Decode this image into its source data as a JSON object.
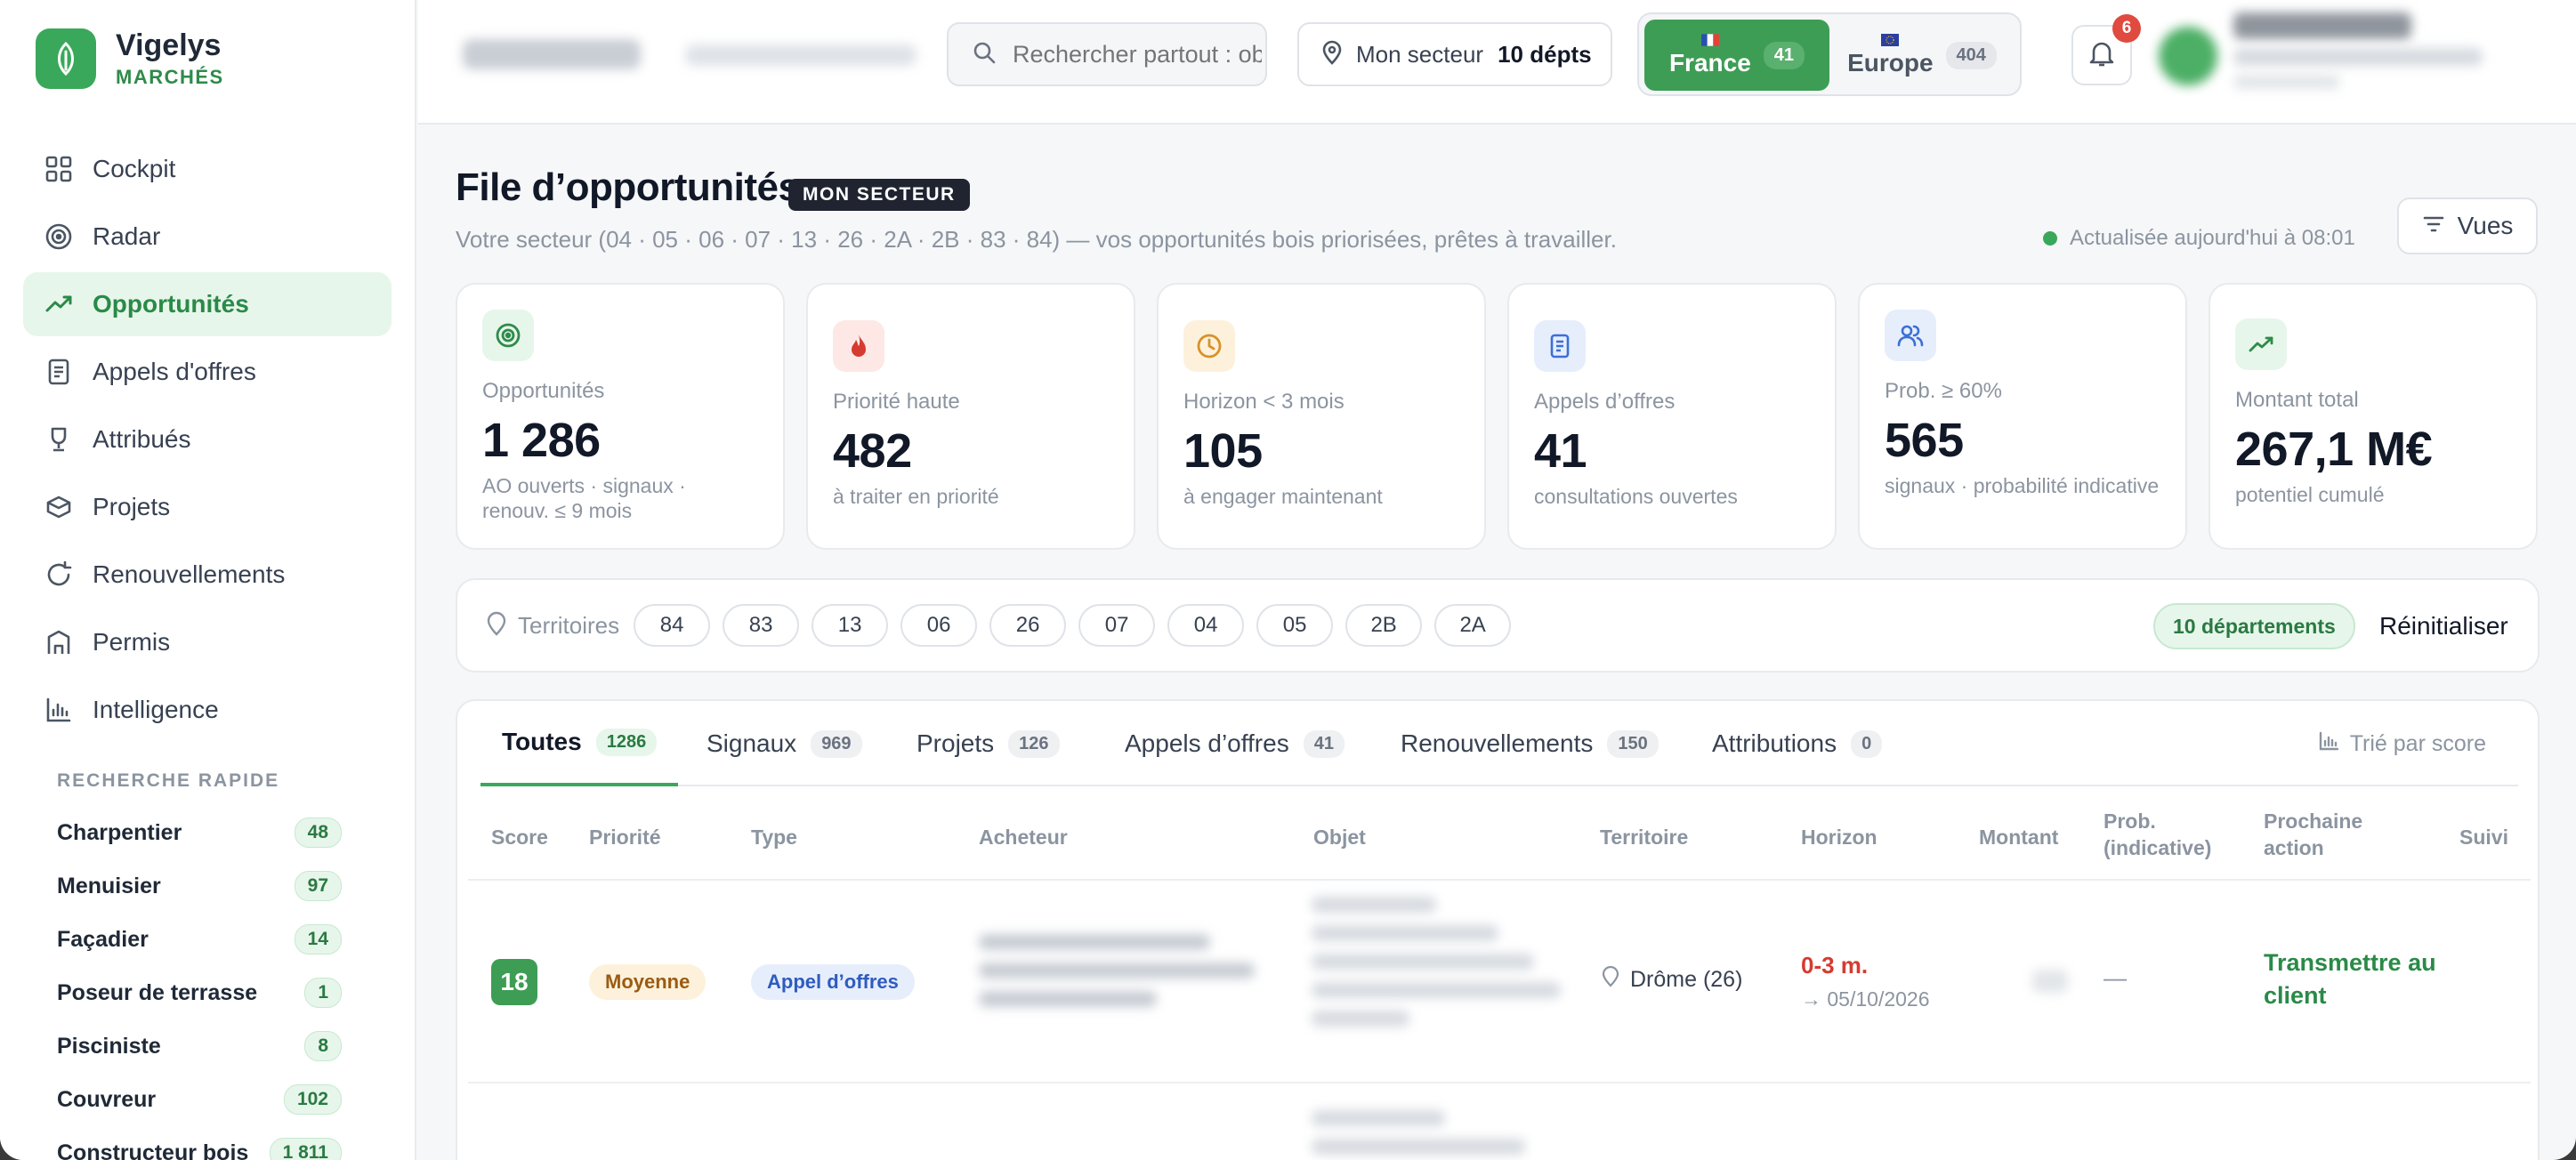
{
  "brand": {
    "name": "Vigelys",
    "sub": "MARCHÉS"
  },
  "sidebar": {
    "items": [
      {
        "label": "Cockpit",
        "icon": "grid-icon"
      },
      {
        "label": "Radar",
        "icon": "target-icon"
      },
      {
        "label": "Opportunités",
        "icon": "trend-icon",
        "active": true
      },
      {
        "label": "Appels d'offres",
        "icon": "document-icon"
      },
      {
        "label": "Attribués",
        "icon": "trophy-icon"
      },
      {
        "label": "Projets",
        "icon": "box-icon"
      },
      {
        "label": "Renouvellements",
        "icon": "refresh-icon"
      },
      {
        "label": "Permis",
        "icon": "building-icon"
      },
      {
        "label": "Intelligence",
        "icon": "bar-chart-icon"
      }
    ],
    "quick_search_title": "RECHERCHE RAPIDE",
    "quick_search": [
      {
        "label": "Charpentier",
        "count": "48"
      },
      {
        "label": "Menuisier",
        "count": "97"
      },
      {
        "label": "Façadier",
        "count": "14"
      },
      {
        "label": "Poseur de terrasse",
        "count": "1"
      },
      {
        "label": "Pisciniste",
        "count": "8"
      },
      {
        "label": "Couvreur",
        "count": "102"
      },
      {
        "label": "Constructeur bois",
        "count": "1 811"
      }
    ]
  },
  "topbar": {
    "search_placeholder": "Rechercher partout : objet, acheteur…",
    "sector_label": "Mon secteur",
    "sector_value": "10 dépts",
    "regions": [
      {
        "name": "France",
        "count": "41",
        "active": true
      },
      {
        "name": "Europe",
        "count": "404",
        "active": false
      }
    ],
    "notifications": "6"
  },
  "page": {
    "title": "File d’opportunités",
    "badge": "MON SECTEUR",
    "subtitle": "Votre secteur (04 · 05 · 06 · 07 · 13 · 26 · 2A · 2B · 83 · 84) — vos opportunités bois priorisées, prêtes à travailler.",
    "updated": "Actualisée aujourd'hui à 08:01",
    "views_label": "Vues"
  },
  "kpis": [
    {
      "label": "Opportunités",
      "value": "1 286",
      "desc": "AO ouverts · signaux · renouv. ≤ 9 mois",
      "icon": "target-icon",
      "color": "#2e8b4a",
      "bg": "#e7f6eb"
    },
    {
      "label": "Priorité haute",
      "value": "482",
      "desc": "à traiter en priorité",
      "icon": "flame-icon",
      "color": "#d63b30",
      "bg": "#fde8e6"
    },
    {
      "label": "Horizon < 3 mois",
      "value": "105",
      "desc": "à engager maintenant",
      "icon": "clock-icon",
      "color": "#d9912a",
      "bg": "#fdf1dc"
    },
    {
      "label": "Appels d’offres",
      "value": "41",
      "desc": "consultations ouvertes",
      "icon": "document-icon",
      "color": "#3b6fd6",
      "bg": "#e6eefc"
    },
    {
      "label": "Prob. ≥ 60%",
      "value": "565",
      "desc": "signaux · probabilité indicative",
      "icon": "users-icon",
      "color": "#3b6fd6",
      "bg": "#e6eefc"
    },
    {
      "label": "Montant total",
      "value": "267,1 M€",
      "desc": "potentiel cumulé",
      "icon": "trend-icon",
      "color": "#2e8b4a",
      "bg": "#e7f6eb"
    }
  ],
  "territories": {
    "label": "Territoires",
    "chips": [
      "84",
      "83",
      "13",
      "06",
      "26",
      "07",
      "04",
      "05",
      "2B",
      "2A"
    ],
    "count_label": "10 départements",
    "reset_label": "Réinitialiser"
  },
  "tabs": [
    {
      "label": "Toutes",
      "count": "1286",
      "active": true
    },
    {
      "label": "Signaux",
      "count": "969"
    },
    {
      "label": "Projets",
      "count": "126"
    },
    {
      "label": "Appels d’offres",
      "count": "41"
    },
    {
      "label": "Renouvellements",
      "count": "150"
    },
    {
      "label": "Attributions",
      "count": "0"
    }
  ],
  "sort_hint": "Trié par score",
  "table": {
    "headers": [
      "Score",
      "Priorité",
      "Type",
      "Acheteur",
      "Objet",
      "Territoire",
      "Horizon",
      "Montant",
      "Prob. (indicative)",
      "Prochaine action",
      "Suivi"
    ],
    "rows": [
      {
        "score": "18",
        "priority": "Moyenne",
        "type": "Appel d’offres",
        "territory": "Drôme (26)",
        "horizon": "0-3 m.",
        "horizon_date": "→ 05/10/2026",
        "prob": "—",
        "next_action": "Transmettre au client"
      }
    ]
  }
}
